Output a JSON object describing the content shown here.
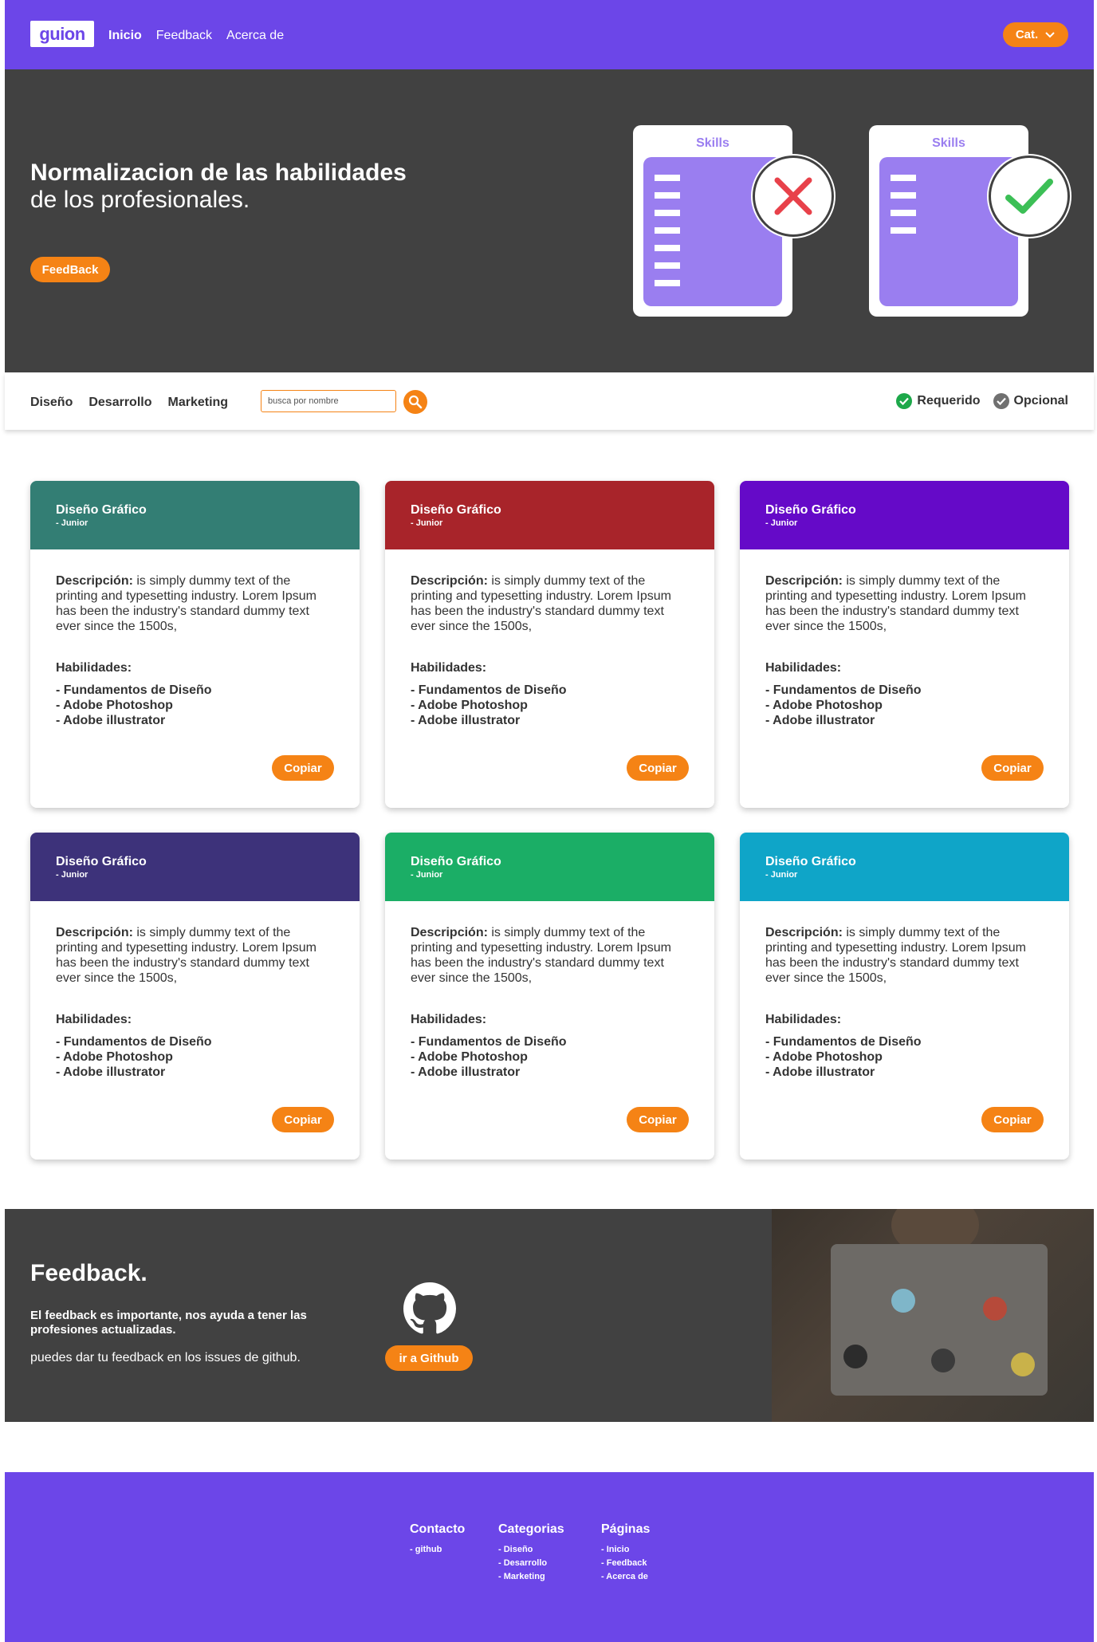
{
  "header": {
    "logo_text": "guion",
    "nav": [
      "Inicio",
      "Feedback",
      "Acerca de"
    ],
    "cat_label": "Cat."
  },
  "hero": {
    "title_line1": "Normalizacion de las habilidades",
    "title_line2": "de los profesionales.",
    "button": "FeedBack",
    "skill_cards": [
      {
        "title": "Skills",
        "status": "x-icon"
      },
      {
        "title": "Skills",
        "status": "check-icon"
      }
    ]
  },
  "filterbar": {
    "filters": [
      "Diseño",
      "Desarrollo",
      "Marketing"
    ],
    "search_placeholder": "busca por nombre",
    "legend": {
      "required": "Requerido",
      "optional": "Opcional"
    }
  },
  "cards": [
    {
      "title": "Diseño Gráfico",
      "subtitle": "- Junior",
      "color": "#337e74",
      "desc_label": "Descripción:",
      "desc": " is simply dummy text of the printing and typesetting industry. Lorem Ipsum has been the industry's standard dummy text ever since the 1500s,",
      "skills_label": "Habilidades:",
      "skills": [
        "- Fundamentos de Diseño",
        "- Adobe Photoshop",
        "- Adobe illustrator"
      ],
      "button": "Copiar"
    },
    {
      "title": "Diseño Gráfico",
      "subtitle": "- Junior",
      "color": "#a8242a",
      "desc_label": "Descripción:",
      "desc": " is simply dummy text of the printing and typesetting industry. Lorem Ipsum has been the industry's standard dummy text ever since the 1500s,",
      "skills_label": "Habilidades:",
      "skills": [
        "- Fundamentos de Diseño",
        "- Adobe Photoshop",
        "- Adobe illustrator"
      ],
      "button": "Copiar"
    },
    {
      "title": "Diseño Gráfico",
      "subtitle": "- Junior",
      "color": "#650ac8",
      "desc_label": "Descripción:",
      "desc": " is simply dummy text of the printing and typesetting industry. Lorem Ipsum has been the industry's standard dummy text ever since the 1500s,",
      "skills_label": "Habilidades:",
      "skills": [
        "- Fundamentos de Diseño",
        "- Adobe Photoshop",
        "- Adobe illustrator"
      ],
      "button": "Copiar"
    },
    {
      "title": "Diseño Gráfico",
      "subtitle": "- Junior",
      "color": "#3d327a",
      "desc_label": "Descripción:",
      "desc": " is simply dummy text of the printing and typesetting industry. Lorem Ipsum has been the industry's standard dummy text ever since the 1500s,",
      "skills_label": "Habilidades:",
      "skills": [
        "- Fundamentos de Diseño",
        "- Adobe Photoshop",
        "- Adobe illustrator"
      ],
      "button": "Copiar"
    },
    {
      "title": "Diseño Gráfico",
      "subtitle": "- Junior",
      "color": "#1bae66",
      "desc_label": "Descripción:",
      "desc": " is simply dummy text of the printing and typesetting industry. Lorem Ipsum has been the industry's standard dummy text ever since the 1500s,",
      "skills_label": "Habilidades:",
      "skills": [
        "- Fundamentos de Diseño",
        "- Adobe Photoshop",
        "- Adobe illustrator"
      ],
      "button": "Copiar"
    },
    {
      "title": "Diseño Gráfico",
      "subtitle": "- Junior",
      "color": "#0fa5c8",
      "desc_label": "Descripción:",
      "desc": " is simply dummy text of the printing and typesetting industry. Lorem Ipsum has been the industry's standard dummy text ever since the 1500s,",
      "skills_label": "Habilidades:",
      "skills": [
        "- Fundamentos de Diseño",
        "- Adobe Photoshop",
        "- Adobe illustrator"
      ],
      "button": "Copiar"
    }
  ],
  "feedback": {
    "title": "Feedback.",
    "text1": "El feedback es importante, nos ayuda a tener las profesiones actualizadas.",
    "text2": "puedes dar tu feedback en los issues de github.",
    "button": "ir a Github"
  },
  "footer": {
    "cols": [
      {
        "heading": "Contacto",
        "items": [
          "- github"
        ]
      },
      {
        "heading": "Categorias",
        "items": [
          "- Diseño",
          "- Desarrollo",
          "- Marketing"
        ]
      },
      {
        "heading": "Páginas",
        "items": [
          "- Inicio",
          "- Feedback",
          "- Acerca de"
        ]
      }
    ]
  },
  "colors": {
    "brand": "#6c46e8",
    "accent": "#f58315",
    "dark": "#414141"
  }
}
